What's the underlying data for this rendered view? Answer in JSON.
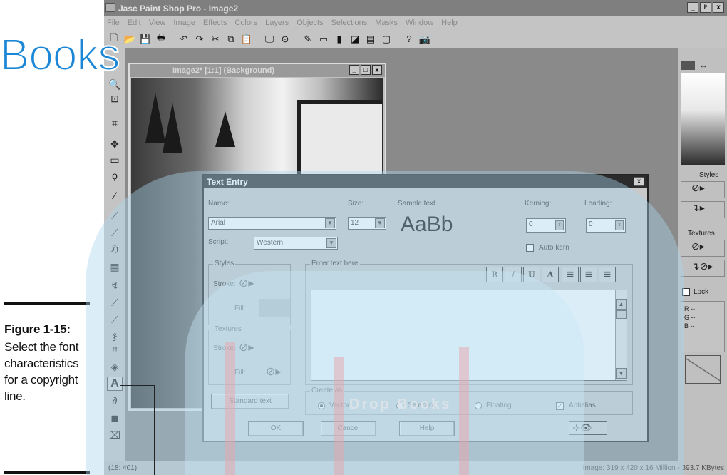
{
  "app": {
    "title": "Jasc Paint Shop Pro - Image2",
    "win_min": "_",
    "win_max": "ᵖ",
    "win_close": "x",
    "menu": [
      "File",
      "Edit",
      "View",
      "Image",
      "Effects",
      "Colors",
      "Layers",
      "Objects",
      "Selections",
      "Masks",
      "Window",
      "Help"
    ]
  },
  "doc": {
    "title": "Image2* [1:1] (Background)",
    "min": "_",
    "max": "□",
    "close": "x"
  },
  "dialog": {
    "title": "Text Entry",
    "close": "x",
    "name_label": "Name:",
    "name_value": "Arial",
    "size_label": "Size:",
    "size_value": "12",
    "sample_label": "Sample text",
    "sample_text": "AaBb",
    "script_label": "Script:",
    "script_value": "Western",
    "kerning_label": "Kerning:",
    "kerning_value": "0",
    "leading_label": "Leading:",
    "leading_value": "0",
    "autokern_label": "Auto kern",
    "styles_group": "Styles",
    "stroke_label": "Stroke:",
    "fill_label": "Fill:",
    "textures_group": "Textures",
    "enter_text_group": "Enter text here",
    "fmt": {
      "bold": "B",
      "italic": "/",
      "underline": "U",
      "strike": "A"
    },
    "create_as_group": "Create as",
    "vector_label": "Vector",
    "selection_label": "Selection",
    "floating_label": "Floating",
    "antialias_label": "Antialias",
    "antialias_check": "✓",
    "standard_text_btn": "Standard text",
    "ok_btn": "OK",
    "cancel_btn": "Cancel",
    "help_btn": "Help"
  },
  "palette": {
    "styles_label": "Styles",
    "textures_label": "Textures",
    "lock_label": "Lock",
    "rgb": [
      "R  --",
      "G  --",
      "B  --"
    ]
  },
  "status": {
    "left": "(18: 401)",
    "right": "Image:  319 x 420 x 16 Million - 393.7 KBytes"
  },
  "caption": {
    "figure": "Figure 1-15:",
    "text": "Select the font characteristics for a copyright line."
  },
  "watermark": {
    "books": "Books",
    "text": "Drop Books"
  }
}
